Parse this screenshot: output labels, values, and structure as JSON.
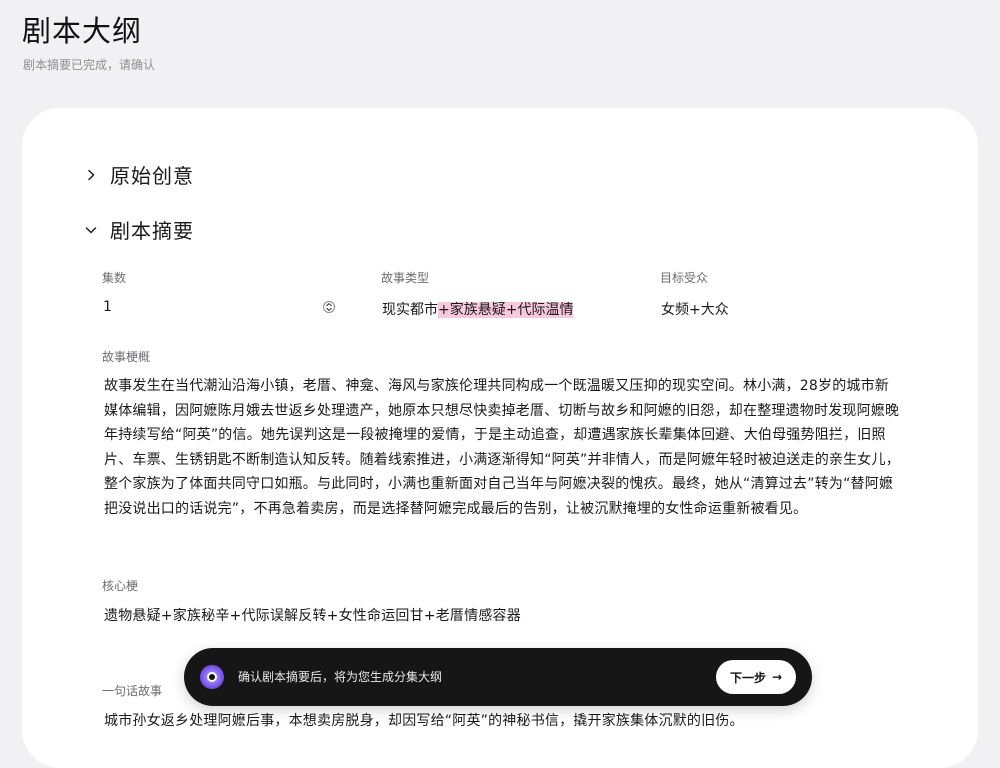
{
  "header": {
    "title": "剧本大纲",
    "subtitle": "剧本摘要已完成，请确认"
  },
  "sections": {
    "original_idea": {
      "label": "原始创意",
      "expanded": false
    },
    "summary": {
      "label": "剧本摘要",
      "expanded": true
    }
  },
  "fields": {
    "episodes": {
      "label": "集数",
      "value": "1"
    },
    "genre": {
      "label": "故事类型",
      "value_plain": "现实都市",
      "value_highlight": "+家族悬疑+代际温情"
    },
    "audience": {
      "label": "目标受众",
      "value": "女频+大众"
    }
  },
  "synopsis": {
    "label": "故事梗概",
    "lines": [
      "故事发生在当代潮汕沿海小镇，老厝、神龛、海风与家族伦理共同构成一个既温暖又压抑的现实空间。林小满，28岁的城市新",
      "媒体编辑，因阿嬷陈月娥去世返乡处理遗产，她原本只想尽快卖掉老厝、切断与故乡和阿嬷的旧怨，却在整理遗物时发现阿嬷晚",
      "年持续写给“阿英”的信。她先误判这是一段被掩埋的爱情，于是主动追查，却遭遇家族长辈集体回避、大伯母强势阻拦，旧照",
      "片、车票、生锈钥匙不断制造认知反转。随着线索推进，小满逐渐得知“阿英”并非情人，而是阿嬷年轻时被迫送走的亲生女儿，",
      "整个家族为了体面共同守口如瓶。与此同时，小满也重新面对自己当年与阿嬷决裂的愧疚。最终，她从“清算过去”转为“替阿嬷",
      "把没说出口的话说完”，不再急着卖房，而是选择替阿嬷完成最后的告别，让被沉默掩埋的女性命运重新被看见。"
    ]
  },
  "core_hook": {
    "label": "核心梗",
    "value": "遗物悬疑+家族秘辛+代际误解反转+女性命运回甘+老厝情感容器"
  },
  "one_liner": {
    "label": "一句话故事",
    "value": "城市孙女返乡处理阿嬷后事，本想卖房脱身，却因写给“阿英”的神秘书信，撬开家族集体沉默的旧伤。"
  },
  "bottom_bar": {
    "message": "确认剧本摘要后，将为您生成分集大纲",
    "next_label": "下一步",
    "next_arrow": "→"
  },
  "icons": {
    "collapsed": "chevron-right-icon",
    "expanded": "chevron-down-icon",
    "stepper": "stepper-icon",
    "avatar": "assistant-avatar-icon"
  },
  "colors": {
    "background": "#f1f1f3",
    "card": "#ffffff",
    "highlight": "#f8c8dc",
    "bar": "#161616"
  }
}
